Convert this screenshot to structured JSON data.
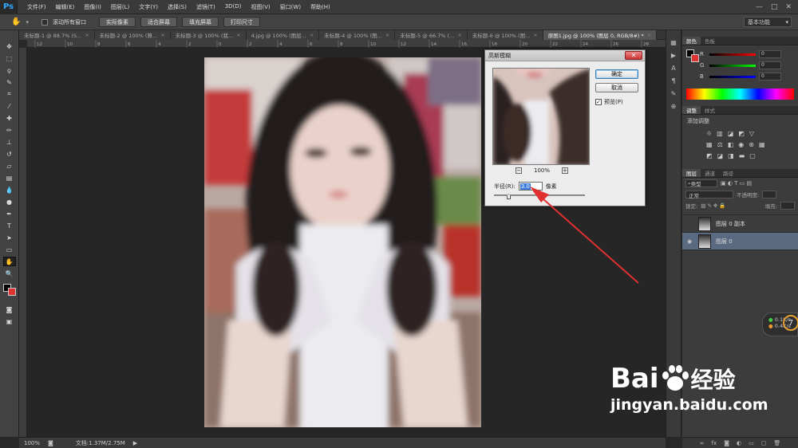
{
  "app": {
    "logo": "Ps"
  },
  "menu": [
    "文件(F)",
    "编辑(E)",
    "图像(I)",
    "图层(L)",
    "文字(Y)",
    "选择(S)",
    "滤镜(T)",
    "3D(D)",
    "视图(V)",
    "窗口(W)",
    "帮助(H)"
  ],
  "options_bar": {
    "scroll_all_label": "滚动所有窗口",
    "buttons": [
      "实际像素",
      "适合屏幕",
      "填充屏幕",
      "打印尺寸"
    ],
    "workspace": "基本功能"
  },
  "tabs": [
    {
      "label": "未标题-1 @ 88.7% (S...",
      "active": false
    },
    {
      "label": "未标题-2 @ 100% (算...",
      "active": false
    },
    {
      "label": "未标题-3 @ 100% (我...",
      "active": false
    },
    {
      "label": "4.jpg @ 100% (图层...",
      "active": false
    },
    {
      "label": "未标题-4 @ 100% (图...",
      "active": false
    },
    {
      "label": "未标题-5 @ 66.7% (...",
      "active": false
    },
    {
      "label": "未标题-6 @ 100% (图...",
      "active": false
    },
    {
      "label": "原图1.jpg @ 100% (图层 0, RGB/8#) *",
      "active": true
    }
  ],
  "ruler_marks": [
    "12",
    "10",
    "8",
    "6",
    "4",
    "2",
    "0",
    "2",
    "4",
    "6",
    "8",
    "10",
    "12",
    "14",
    "16",
    "18",
    "20",
    "22",
    "24",
    "26",
    "28"
  ],
  "dialog": {
    "title": "高斯模糊",
    "ok": "确定",
    "cancel": "取消",
    "preview_label": "预览(P)",
    "preview_checked": true,
    "zoom": "100%",
    "zoom_minus": "−",
    "zoom_plus": "+",
    "radius_label": "半径(R):",
    "radius_value": "3.0",
    "unit": "像素"
  },
  "panels": {
    "color_tabs": [
      "颜色",
      "色板"
    ],
    "rgb_labels": [
      "R",
      "G",
      "B"
    ],
    "rgb_values": [
      "0",
      "0",
      "0"
    ],
    "adjust_tabs": [
      "调整",
      "样式"
    ],
    "adjust_title": "添加调整",
    "layers_tabs": [
      "图层",
      "通道",
      "路径"
    ],
    "filter_kind": "类型",
    "blend_mode": "正常",
    "opacity_label": "不透明度:",
    "lock_label": "锁定:",
    "fill_label": "填充:",
    "layers": [
      {
        "name": "图层 0 副本",
        "visible": false,
        "selected": false
      },
      {
        "name": "图层 0",
        "visible": true,
        "selected": true
      }
    ]
  },
  "status": {
    "zoom": "100%",
    "doc": "文档:1.37M/2.75M"
  },
  "net_widget": {
    "up": "0.1",
    "down": "0.4",
    "unit": "K/s",
    "badge": "7"
  },
  "watermark": {
    "brand": "Bai",
    "brand2": "经验",
    "url": "jingyan.baidu.com"
  },
  "colors": {
    "accent_red": "#e03030",
    "fg": "#000000",
    "bg": "#d33333"
  }
}
